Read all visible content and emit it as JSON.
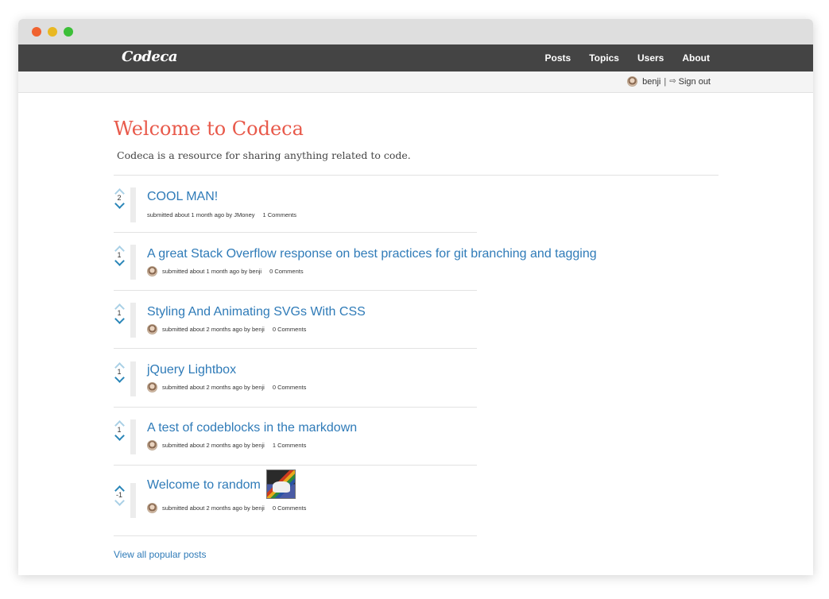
{
  "app": {
    "brand": "Codeca"
  },
  "nav": {
    "items": [
      "Posts",
      "Topics",
      "Users",
      "About"
    ]
  },
  "userbar": {
    "username": "benji",
    "separator": "|",
    "signout": "Sign out"
  },
  "hero": {
    "title": "Welcome to Codeca",
    "subtitle": "Codeca is a resource for sharing anything related to code."
  },
  "posts": [
    {
      "title": "COOL MAN!",
      "votes": "2",
      "meta": "submitted about 1 month ago by JMoney",
      "comments": "1 Comments",
      "has_avatar": false,
      "has_thumbnail": false
    },
    {
      "title": "A great Stack Overflow response on best practices for git branching and tagging",
      "votes": "1",
      "meta": "submitted about 1 month ago by benji",
      "comments": "0 Comments",
      "has_avatar": true,
      "has_thumbnail": false
    },
    {
      "title": "Styling And Animating SVGs With CSS",
      "votes": "1",
      "meta": "submitted about 2 months ago by benji",
      "comments": "0 Comments",
      "has_avatar": true,
      "has_thumbnail": false
    },
    {
      "title": "jQuery Lightbox",
      "votes": "1",
      "meta": "submitted about 2 months ago by benji",
      "comments": "0 Comments",
      "has_avatar": true,
      "has_thumbnail": false
    },
    {
      "title": "A test of codeblocks in the markdown",
      "votes": "1",
      "meta": "submitted about 2 months ago by benji",
      "comments": "1 Comments",
      "has_avatar": true,
      "has_thumbnail": false
    },
    {
      "title": "Welcome to random",
      "votes": "-1",
      "meta": "submitted about 2 months ago by benji",
      "comments": "0 Comments",
      "has_avatar": true,
      "has_thumbnail": true
    }
  ],
  "footer": {
    "view_all": "View all popular posts"
  },
  "colors": {
    "accent": "#e8594a",
    "link": "#2f7bb8",
    "navbar": "#444444"
  }
}
